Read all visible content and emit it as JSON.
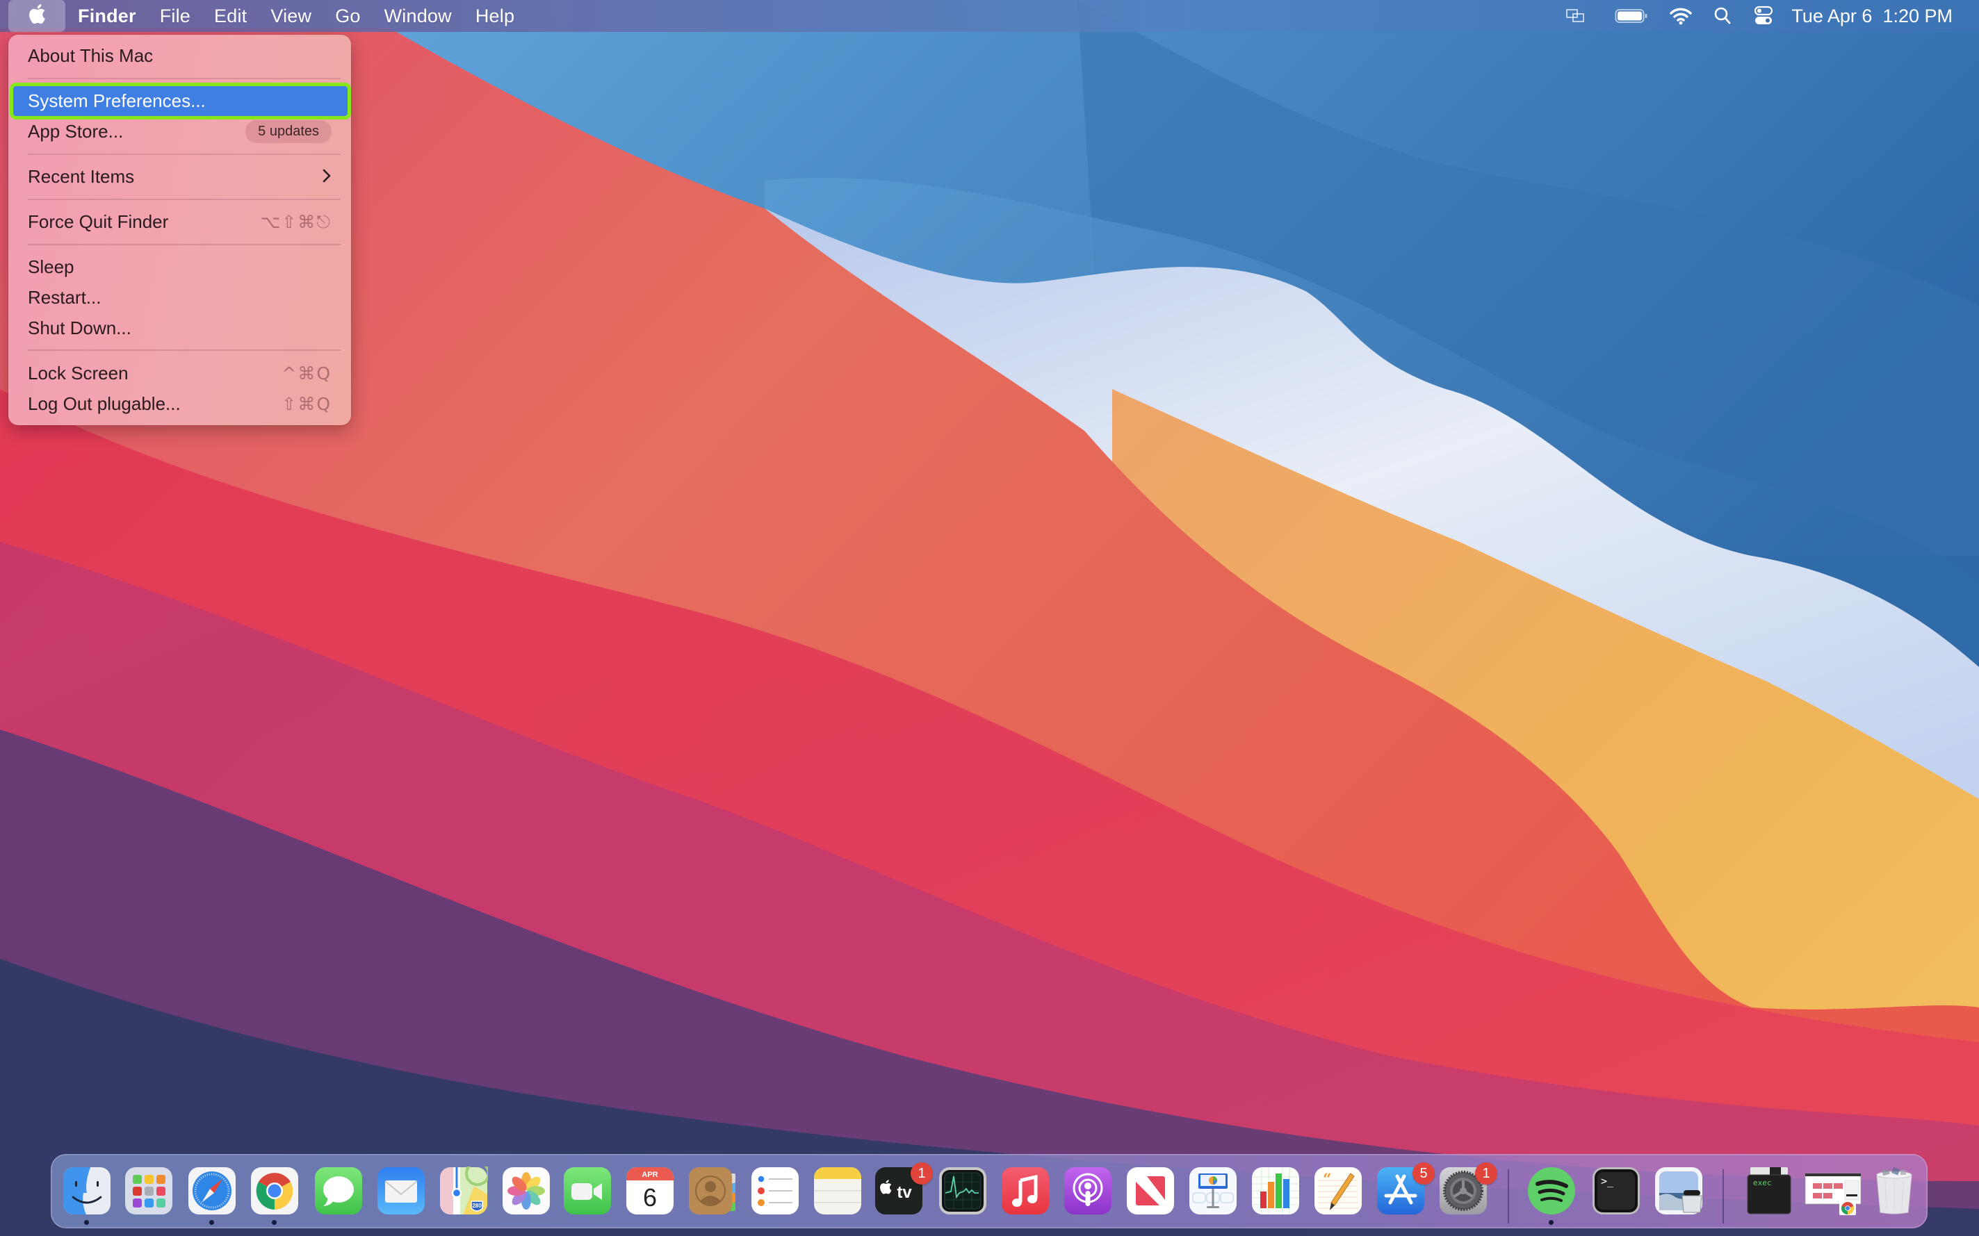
{
  "menubar": {
    "apple_icon": "apple-logo-icon",
    "app_name": "Finder",
    "menus": [
      "File",
      "Edit",
      "View",
      "Go",
      "Window",
      "Help"
    ],
    "status_icons": [
      "screen-mirroring-icon",
      "battery-icon",
      "wifi-icon",
      "spotlight-search-icon",
      "control-center-icon"
    ],
    "clock": "Tue Apr 6  1:20 PM"
  },
  "apple_menu": {
    "items": [
      {
        "label": "About This Mac"
      },
      {
        "label": "System Preferences...",
        "selected": true
      },
      {
        "label": "App Store...",
        "badge": "5 updates"
      },
      {
        "label": "Recent Items",
        "submenu": true
      },
      {
        "label": "Force Quit Finder",
        "shortcut": "⌥⇧⌘⎋"
      },
      {
        "label": "Sleep"
      },
      {
        "label": "Restart..."
      },
      {
        "label": "Shut Down..."
      },
      {
        "label": "Lock Screen",
        "shortcut": "^⌘Q"
      },
      {
        "label": "Log Out plugable...",
        "shortcut": "⇧⌘Q"
      }
    ],
    "highlight_color": "#3f7ee3",
    "focus_outline_color": "#86e81a"
  },
  "dock": {
    "apps": [
      {
        "name": "Finder",
        "running": true
      },
      {
        "name": "Launchpad"
      },
      {
        "name": "Safari",
        "running": true
      },
      {
        "name": "Google Chrome",
        "running": true
      },
      {
        "name": "Messages"
      },
      {
        "name": "Mail"
      },
      {
        "name": "Maps",
        "sign": "280"
      },
      {
        "name": "Photos"
      },
      {
        "name": "FaceTime"
      },
      {
        "name": "Calendar",
        "month": "APR",
        "day": "6"
      },
      {
        "name": "Contacts"
      },
      {
        "name": "Reminders"
      },
      {
        "name": "Notes"
      },
      {
        "name": "TV",
        "badge": "1",
        "label": "tv"
      },
      {
        "name": "Activity Monitor"
      },
      {
        "name": "Music"
      },
      {
        "name": "Podcasts"
      },
      {
        "name": "News"
      },
      {
        "name": "Keynote"
      },
      {
        "name": "Numbers"
      },
      {
        "name": "Pages"
      },
      {
        "name": "App Store",
        "badge": "5"
      },
      {
        "name": "System Preferences",
        "badge": "1"
      },
      {
        "name": "Spotify",
        "running": true
      },
      {
        "name": "Terminal",
        "prompt": ">_"
      },
      {
        "name": "Preview"
      },
      {
        "name": "exec",
        "label": "exec"
      },
      {
        "name": "Chrome Screenshot"
      },
      {
        "name": "Trash"
      }
    ]
  }
}
